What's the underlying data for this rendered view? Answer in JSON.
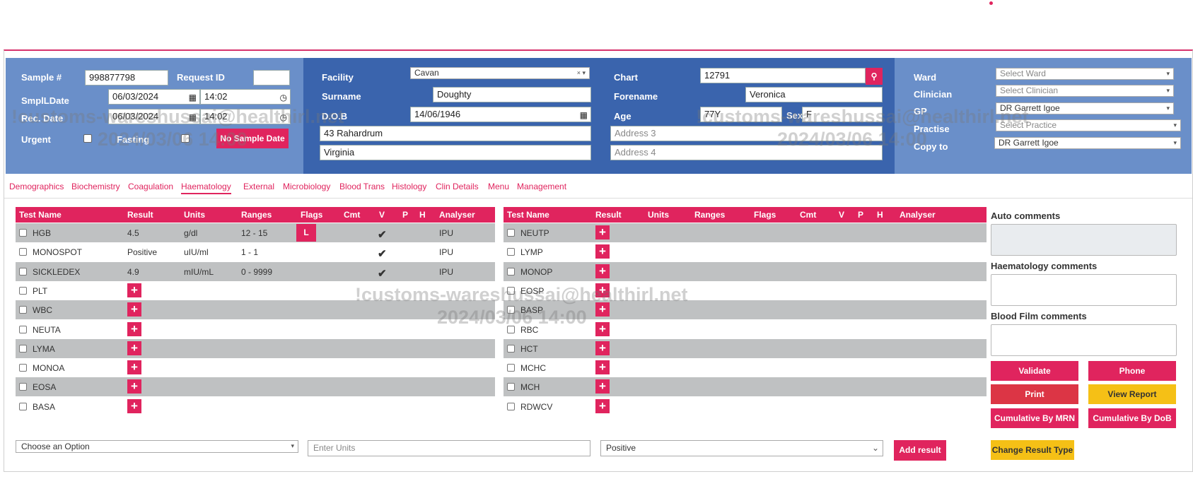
{
  "header": {
    "sample_label": "Sample #",
    "sample_value": "998877798",
    "request_id_label": "Request ID",
    "request_id_value": "",
    "smpl_date_label": "SmplLDate",
    "smpl_date_value": "06/03/2024",
    "smpl_time_value": "14:02",
    "rec_date_label": "Rec. Date",
    "rec_date_value": "06/03/2024",
    "rec_time_value": "14:02",
    "urgent_label": "Urgent",
    "fasting_label": "Fasting",
    "no_sample_date_label": "No Sample Date",
    "facility_label": "Facility",
    "facility_value": "Cavan",
    "surname_label": "Surname",
    "surname_value": "Doughty",
    "dob_label": "D.O.B",
    "dob_value": "14/06/1946",
    "address1_value": "43 Rahardrum",
    "address2_value": "Virginia",
    "chart_label": "Chart",
    "chart_value": "12791",
    "forename_label": "Forename",
    "forename_value": "Veronica",
    "age_label": "Age",
    "age_value": "77Y",
    "sex_label": "Sex",
    "sex_value": "F",
    "address3_placeholder": "Address 3",
    "address4_placeholder": "Address 4",
    "ward_label": "Ward",
    "ward_placeholder": "Select Ward",
    "clinician_label": "Clinician",
    "clinician_placeholder": "Select Clinician",
    "gp_label": "GP",
    "gp_value": "DR Garrett Igoe",
    "practise_label": "Practise",
    "practise_placeholder": "Select Practice",
    "copy_to_label": "Copy to",
    "copy_to_value": "DR Garrett Igoe"
  },
  "watermark": {
    "line1": "!customs-wareshussai@healthirl.net",
    "line2": "2024/03/06 14:00"
  },
  "tabs": [
    "Demographics",
    "Biochemistry",
    "Coagulation",
    "Haematology",
    "External",
    "Microbiology",
    "Blood Trans",
    "Histology",
    "Clin Details",
    "Menu",
    "Management"
  ],
  "active_tab": "Haematology",
  "grid_columns": [
    "Test Name",
    "Result",
    "Units",
    "Ranges",
    "Flags",
    "Cmt",
    "V",
    "P",
    "H",
    "Analyser"
  ],
  "left_grid": [
    {
      "name": "HGB",
      "result": "4.5",
      "units": "g/dl",
      "ranges": "12 - 15",
      "flag": "L",
      "validated": true,
      "analyser": "IPU"
    },
    {
      "name": "MONOSPOT",
      "result": "Positive",
      "units": "uIU/ml",
      "ranges": "1 - 1",
      "flag": "",
      "validated": true,
      "analyser": "IPU"
    },
    {
      "name": "SICKLEDEX",
      "result": "4.9",
      "units": "mIU/mL",
      "ranges": "0 - 9999",
      "flag": "",
      "validated": true,
      "analyser": "IPU"
    },
    {
      "name": "PLT"
    },
    {
      "name": "WBC"
    },
    {
      "name": "NEUTA"
    },
    {
      "name": "LYMA"
    },
    {
      "name": "MONOA"
    },
    {
      "name": "EOSA"
    },
    {
      "name": "BASA"
    }
  ],
  "right_grid": [
    {
      "name": "NEUTP"
    },
    {
      "name": "LYMP"
    },
    {
      "name": "MONOP"
    },
    {
      "name": "EOSP"
    },
    {
      "name": "BASP"
    },
    {
      "name": "RBC"
    },
    {
      "name": "HCT"
    },
    {
      "name": "MCHC"
    },
    {
      "name": "MCH"
    },
    {
      "name": "RDWCV"
    }
  ],
  "side": {
    "auto_comments_label": "Auto comments",
    "haem_comments_label": "Haematology comments",
    "blood_film_label": "Blood Film comments",
    "validate_label": "Validate",
    "phone_label": "Phone",
    "print_label": "Print",
    "view_report_label": "View Report",
    "cum_mrn_label": "Cumulative By MRN",
    "cum_dob_label": "Cumulative By DoB",
    "change_result_type_label": "Change Result Type"
  },
  "bottom": {
    "option_placeholder": "Choose an Option",
    "units_placeholder": "Enter Units",
    "result_value": "Positive",
    "add_result_label": "Add result"
  },
  "colors": {
    "accent": "#e0245e",
    "header_light": "#6a8fc9",
    "header_dark": "#3a64ad",
    "row_gray": "#bfc1c2",
    "yellow": "#f5c016"
  }
}
